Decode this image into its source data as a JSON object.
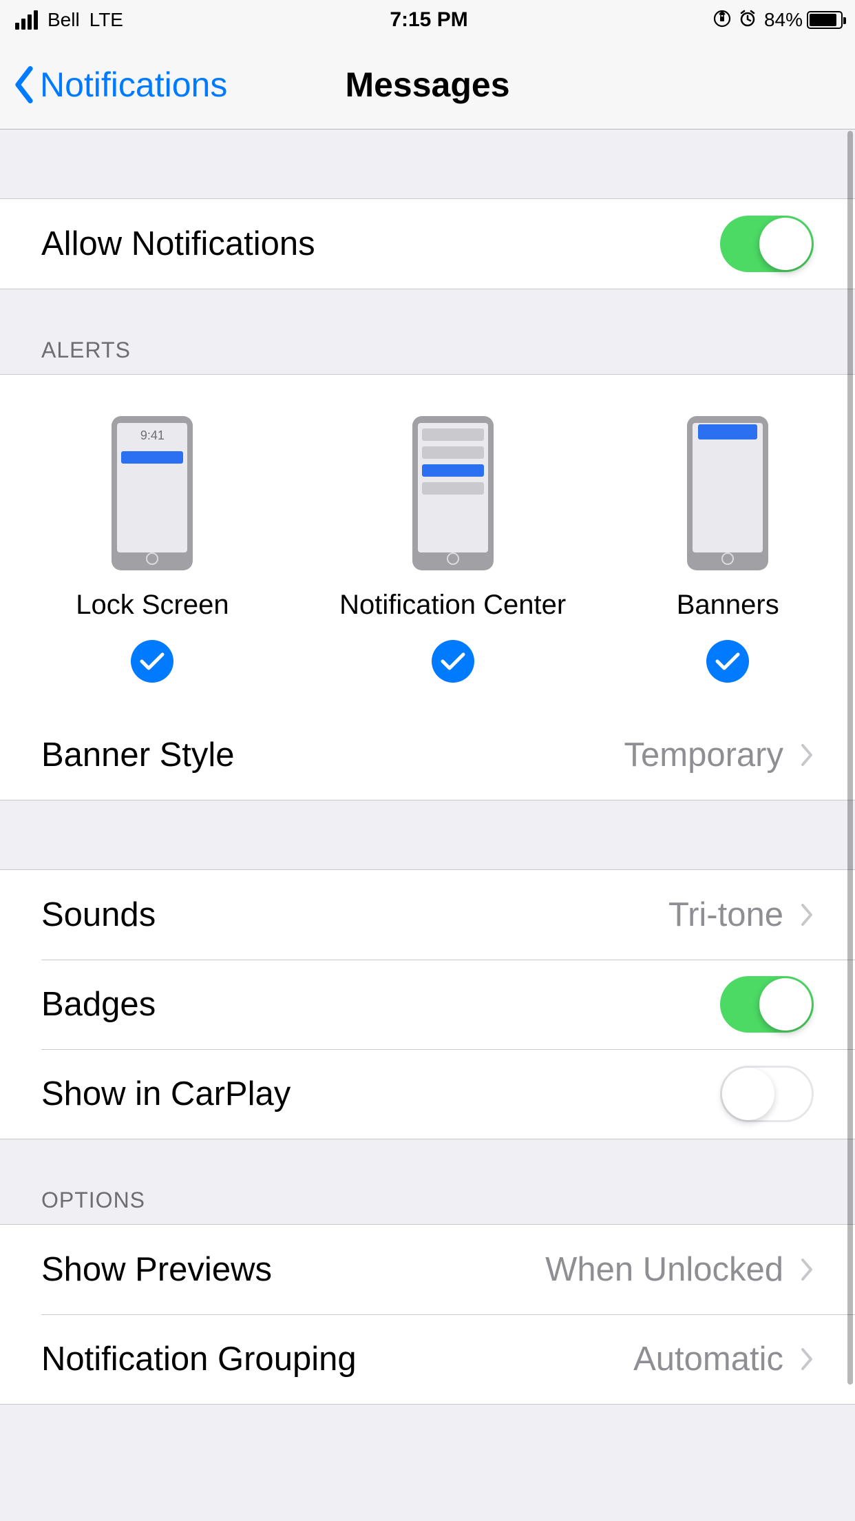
{
  "status_bar": {
    "carrier": "Bell",
    "network": "LTE",
    "time": "7:15 PM",
    "battery_percent": "84%"
  },
  "nav": {
    "back_label": "Notifications",
    "title": "Messages"
  },
  "allow_notifications": {
    "label": "Allow Notifications",
    "on": true
  },
  "alerts": {
    "header": "ALERTS",
    "types": [
      {
        "label": "Lock Screen",
        "checked": true,
        "preview_time": "9:41"
      },
      {
        "label": "Notification Center",
        "checked": true
      },
      {
        "label": "Banners",
        "checked": true
      }
    ],
    "banner_style": {
      "label": "Banner Style",
      "value": "Temporary"
    }
  },
  "second_group": {
    "sounds": {
      "label": "Sounds",
      "value": "Tri-tone"
    },
    "badges": {
      "label": "Badges",
      "on": true
    },
    "carplay": {
      "label": "Show in CarPlay",
      "on": false
    }
  },
  "options": {
    "header": "OPTIONS",
    "show_previews": {
      "label": "Show Previews",
      "value": "When Unlocked"
    },
    "grouping": {
      "label": "Notification Grouping",
      "value": "Automatic"
    }
  }
}
